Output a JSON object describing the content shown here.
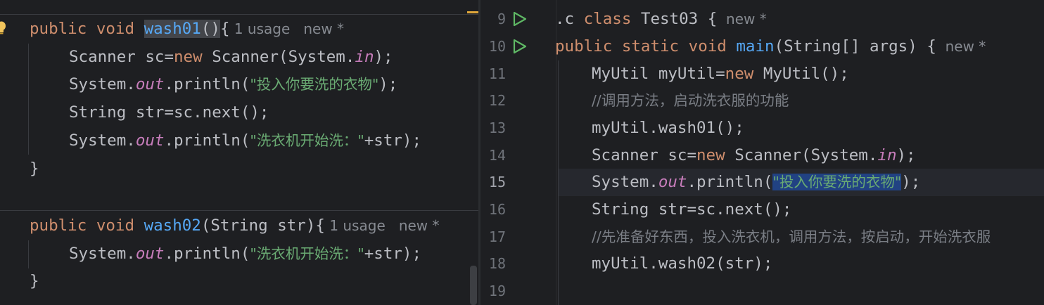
{
  "left_editor": {
    "method1": {
      "l1": {
        "mod": "public void ",
        "name": "wash01",
        "parens": "()",
        "brace": "{",
        "hint_usage": "1 usage",
        "hint_new": "new *"
      },
      "l2": {
        "a": "Scanner sc=",
        "kw": "new",
        "b": " Scanner(System.",
        "field": "in",
        "c": ");"
      },
      "l3": {
        "a": "System.",
        "field": "out",
        "b": ".println(",
        "str": "\"投入你要洗的衣物\"",
        "c": ");"
      },
      "l4": {
        "a": "String str=sc.next();"
      },
      "l5": {
        "a": "System.",
        "field": "out",
        "b": ".println(",
        "str": "\"洗衣机开始洗：\"",
        "c": "+str);"
      },
      "l6": {
        "a": "}"
      }
    },
    "method2": {
      "l1": {
        "mod": "public void ",
        "name": "wash02",
        "rest": "(String str){",
        "hint_usage": "1 usage",
        "hint_new": "new *"
      },
      "l2": {
        "a": "System.",
        "field": "out",
        "b": ".println(",
        "str": "\"洗衣机开始洗：\"",
        "c": "+str);"
      },
      "l3": {
        "a": "}"
      }
    }
  },
  "right_editor": {
    "line_numbers": [
      "9",
      "10",
      "11",
      "12",
      "13",
      "14",
      "15",
      "16",
      "17",
      "18",
      "19"
    ],
    "l9": {
      "a": ".c ",
      "kw": "class",
      "b": " Test03 {",
      "hint_new": "new *"
    },
    "l10": {
      "kw1": "public static void ",
      "name": "main",
      "rest": "(String[] args) {",
      "hint_new": "new *"
    },
    "l11": {
      "a": "MyUtil myUtil=",
      "kw": "new",
      "b": " MyUtil();"
    },
    "l12": {
      "comment": "//调用方法，启动洗衣服的功能"
    },
    "l13": {
      "a": "myUtil.wash01();"
    },
    "l14": {
      "a": "Scanner sc=",
      "kw": "new",
      "b": " Scanner(System.",
      "field": "in",
      "c": ");"
    },
    "l15": {
      "a": "System.",
      "field": "out",
      "b": ".println(",
      "str": "\"投入你要洗的衣物\"",
      "c": ");"
    },
    "l16": {
      "a": "String str=sc.next();"
    },
    "l17": {
      "comment": "//先准备好东西，投入洗衣机，调用方法，按启动，开始洗衣服"
    },
    "l18": {
      "a": "myUtil.wash02(str);"
    }
  },
  "colors": {
    "keyword": "#cf8e6d",
    "function": "#56a8f5",
    "string": "#6aab73",
    "static_field": "#c77dbb",
    "comment": "#7a7e85",
    "selection": "#214283",
    "run_icon": "#5fb865"
  },
  "icons": {
    "run": "run-gutter-icon",
    "bulb": "intention-bulb-icon"
  }
}
